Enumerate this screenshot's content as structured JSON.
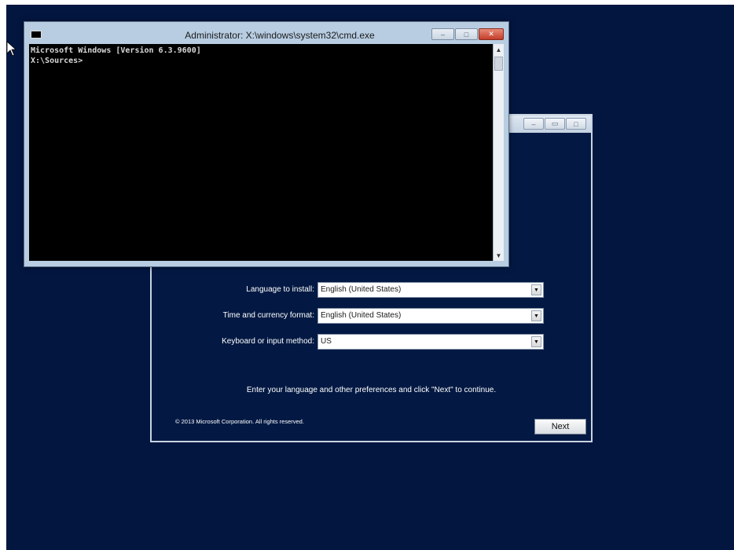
{
  "cmd_window": {
    "title": "Administrator: X:\\windows\\system32\\cmd.exe",
    "minimize_glyph": "–",
    "maximize_glyph": "□",
    "close_glyph": "✕",
    "console_lines": [
      "Microsoft Windows [Version 6.3.9600]",
      "",
      "X:\\Sources>"
    ],
    "scroll_up_glyph": "▲",
    "scroll_down_glyph": "▼"
  },
  "setup_window": {
    "minimize_glyph": "–",
    "restore_glyph": "▭",
    "maximize_glyph": "□",
    "fields": [
      {
        "label": "Language to install:",
        "value": "English (United States)"
      },
      {
        "label": "Time and currency format:",
        "value": "English (United States)"
      },
      {
        "label": "Keyboard or input method:",
        "value": "US"
      }
    ],
    "dropdown_glyph": "▼",
    "instruction": "Enter your language and other preferences and click \"Next\" to continue.",
    "copyright": "© 2013 Microsoft Corporation. All rights reserved.",
    "next_label": "Next"
  },
  "colors": {
    "desktop": "#031640",
    "console_bg": "#000000",
    "cmd_frame": "#b8cde2"
  }
}
